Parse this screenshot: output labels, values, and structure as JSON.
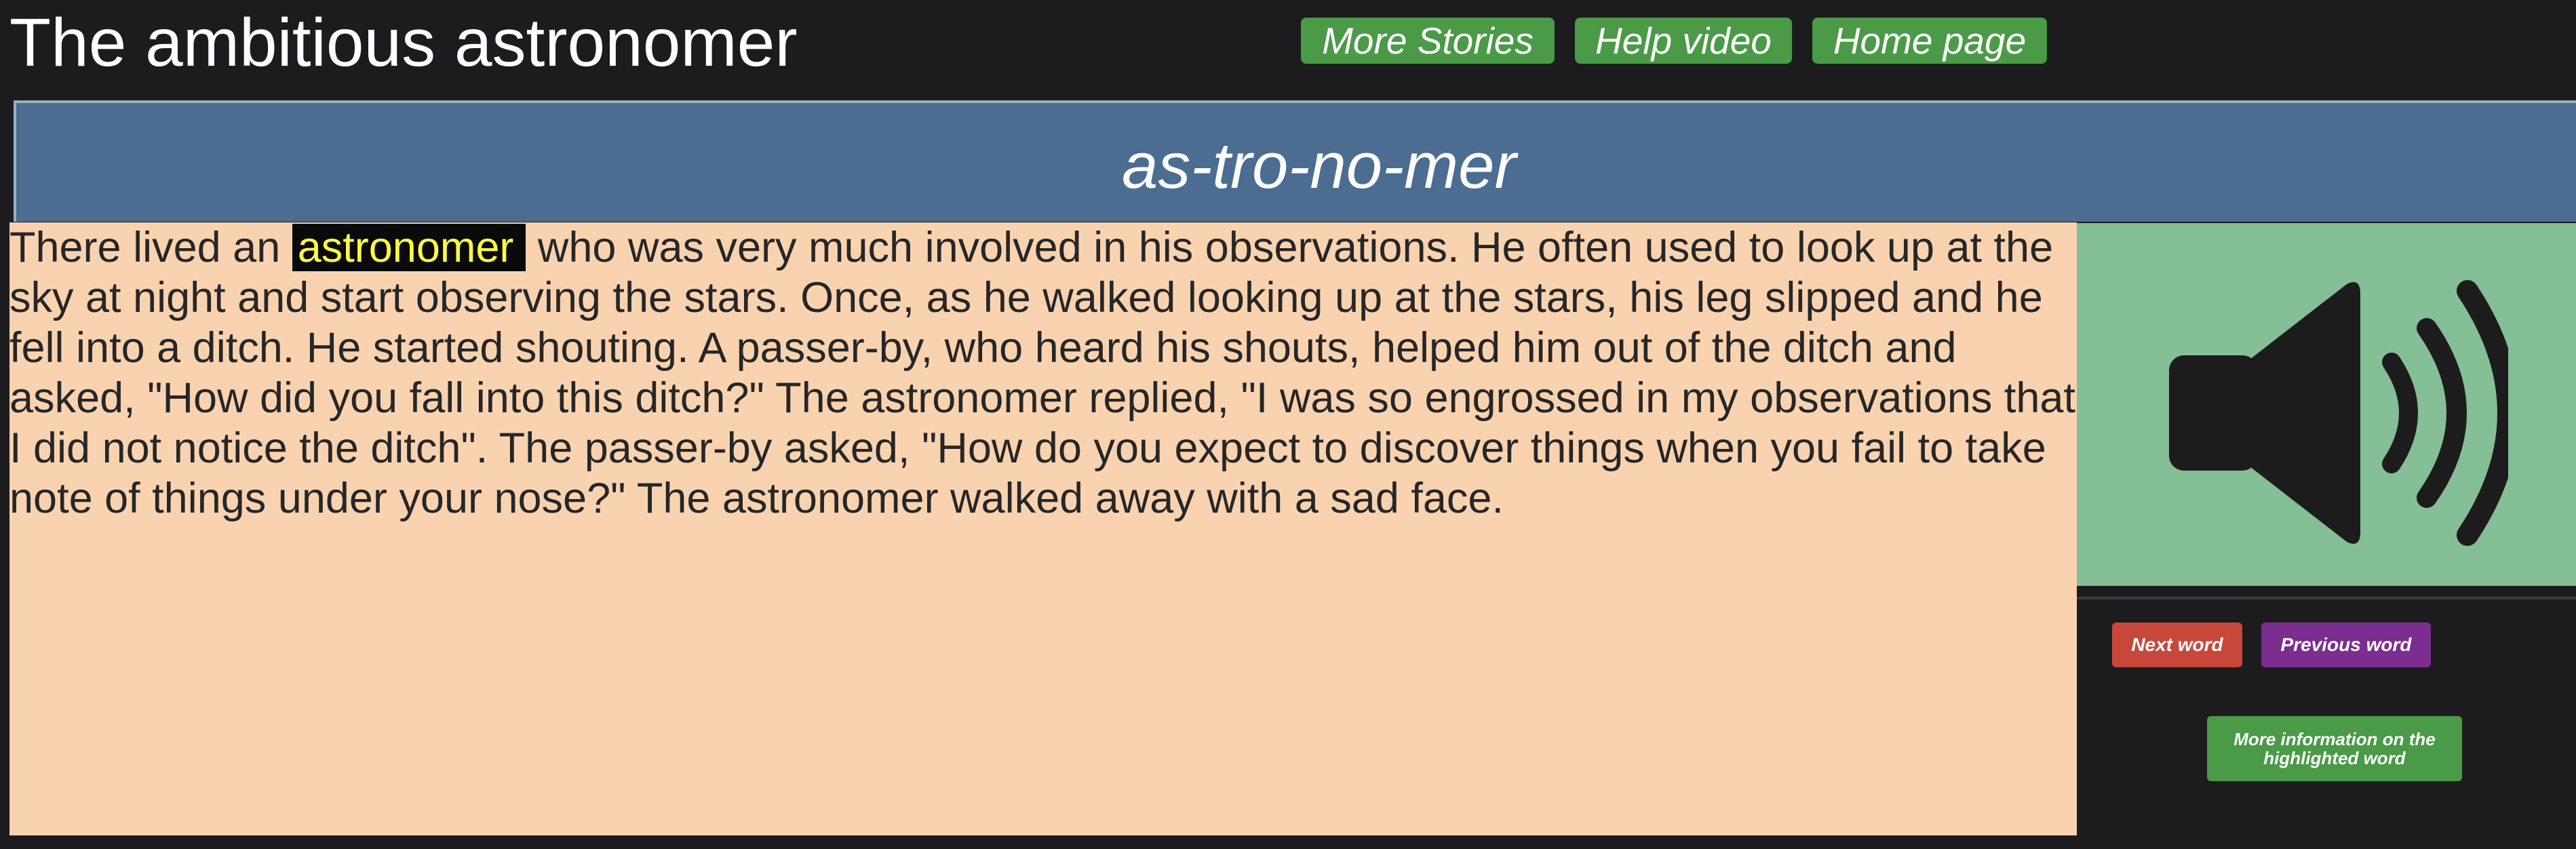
{
  "page": {
    "title": "The ambitious astronomer"
  },
  "nav": {
    "more_stories": "More Stories",
    "help_video": "Help video",
    "home_page": "Home page"
  },
  "syllables": "as-tro-no-mer",
  "story": {
    "before_highlight": "There lived an ",
    "highlighted_word": "astronomer",
    "after_highlight": " who was very much involved in his observations. He often used to look up at the sky at night and start observing the stars. Once, as he walked looking up at the stars, his leg slipped and he fell into a ditch. He started shouting. A passer-by, who heard his shouts, helped him out of the ditch and asked, \"How did you fall into this ditch?\" The astronomer replied, \"I was so engrossed in my observations that I did not notice the ditch\". The passer-by asked, \"How do you expect to discover things when you fail to take note of things under your nose?\" The astronomer walked away with a sad face."
  },
  "controls": {
    "next_word": "Next word",
    "previous_word": "Previous word",
    "more_info": "More information on the highlighted word",
    "speaker_icon": "speaker-volume-icon"
  },
  "colors": {
    "background": "#1c1c1e",
    "nav_button": "#4a9a47",
    "syllable_bar": "#4a6d91",
    "story_panel": "#f9d3b0",
    "speaker_panel": "#85bf95",
    "highlight_bg": "#0a0a0a",
    "highlight_text": "#ffff40",
    "next_button": "#c8473b",
    "previous_button": "#7b2e8e"
  }
}
